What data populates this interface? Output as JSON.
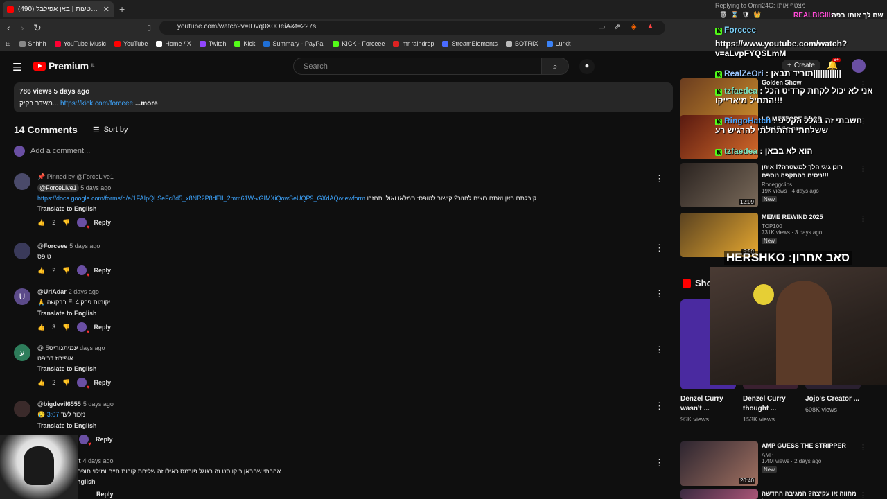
{
  "browser": {
    "tab_title": "(490) זו הייתה טעות | באן אפילבל",
    "tab_close": "✕",
    "new_tab": "+",
    "url": "youtube.com/watch?v=IDvq0X0OeiA&t=227s",
    "bookmarks": [
      "Shhhh",
      "YouTube Music",
      "YouTube",
      "Home / X",
      "Twitch",
      "Kick",
      "Summary - PayPal",
      "KICK - Forceee",
      "mr raindrop",
      "StreamElements",
      "BOTRIX",
      "Lurkit"
    ],
    "bookmark_colors": [
      "#888888",
      "#ff0033",
      "#ff0000",
      "#ffffff",
      "#9146ff",
      "#53fc18",
      "#1f6fd6",
      "#53fc18",
      "#d22",
      "#4a6bff",
      "#bbbbbb",
      "#3b82f6"
    ]
  },
  "youtube": {
    "logo_text": "Premium",
    "logo_sup": "IL",
    "search_placeholder": "Search",
    "create_label": "Create",
    "notif_count": "9+"
  },
  "description": {
    "views_line": "786 views  5 days ago",
    "text_prefix": "משדר בקיק...",
    "link": "https://kick.com/forceee",
    "more": "...more"
  },
  "comments": {
    "count_label": "14 Comments",
    "sort_label": "Sort by",
    "add_placeholder": "Add a comment...",
    "items": [
      {
        "pinned": "Pinned by @ForceLive1",
        "author": "@ForceLive1",
        "date": "5 days ago",
        "link": "https://docs.google.com/forms/d/e/1FAIpQLSeFc8d5_x8NR2P8dEII_2mm61W-vGIMXiQowSeUQP9_GXdAQ/viewform",
        "text": "קיבלתם באן ואתם רוצים לחזור?  קישור לטופס:  תמלאו ואולי תחזרו",
        "translate": "Translate to English",
        "likes": "2",
        "reply": "Reply"
      },
      {
        "author": "@Forceee",
        "date": "5 days ago",
        "text": "טופס",
        "likes": "2",
        "reply": "Reply"
      },
      {
        "author": "@UriAdar",
        "date": "2 days ago",
        "text": "🙏 בבקשה Ei 4 יקומות פרק",
        "translate": "Translate to English",
        "likes": "3",
        "reply": "Reply",
        "avatar_letter": "U"
      },
      {
        "author": "@עמיתנוריס",
        "date": "5 days ago",
        "text": "אופירוז דריפט",
        "translate": "Translate to English",
        "likes": "2",
        "reply": "Reply",
        "avatar_letter": "ע"
      },
      {
        "author": "@bigdevil6555",
        "date": "5 days ago",
        "text_prefix": "😢 נזכור לעד",
        "timestamp": "3:07",
        "translate": "Translate to English",
        "reply": "Reply"
      },
      {
        "author": "it",
        "date": "4 days ago",
        "text": "אהבתי שהבאן ריקווסט זה בגוגל פורמס כאילו זה שליחת קורות חיים ומילוי תופס",
        "translate": "nglish",
        "reply": "Reply"
      }
    ]
  },
  "sidebar": {
    "recs": [
      {
        "title": "Golden Show",
        "channel": "",
        "meta": "",
        "duration": "",
        "colors": [
          "#6b3d1f",
          "#c98a2b"
        ]
      },
      {
        "title": "LO METZOPE SOCR",
        "channel": "Bazzi B // תוכניות",
        "meta": "",
        "duration": "",
        "colors": [
          "#5a1a10",
          "#d46a2a"
        ]
      },
      {
        "title": "רונן גיגי הלך למשטרה?! איתן ניסים בהתקפה נוספת!!!",
        "channel": "Roneggclips",
        "meta": "19K views · 4 days ago",
        "duration": "12:09",
        "badge": "New",
        "colors": [
          "#2a2320",
          "#7a6a5a"
        ]
      },
      {
        "title": "MEME REWIND 2025",
        "channel": "TOP100",
        "meta": "731K views · 3 days ago",
        "duration": "6:50",
        "badge": "New",
        "colors": [
          "#5a4220",
          "#e6a830"
        ]
      },
      {
        "title": "AMP GUESS THE STRIPPER",
        "channel": "AMP",
        "meta": "1.4M views · 2 days ago",
        "duration": "20:40",
        "badge": "New",
        "colors": [
          "#2d2530",
          "#a07060"
        ]
      },
      {
        "title": "מחווה או עקיצה? המגיבה החדשה של",
        "channel": "",
        "meta": "",
        "duration": "",
        "colors": [
          "#3a2a40",
          "#aa5577"
        ]
      }
    ],
    "shorts_label": "Sho",
    "shorts": [
      {
        "title": "Denzel Curry wasn't ...",
        "views": "95K views",
        "color": "#4a2aa0"
      },
      {
        "title": "Denzel Curry thought ...",
        "views": "153K views",
        "color": "#3a2030"
      },
      {
        "title": "Jojo's Creator ...",
        "views": "608K views",
        "color": "#2a2030"
      }
    ]
  },
  "chat": {
    "replying": "Replying to Omri24G: מצטף אותו",
    "realbig": "REALBIGIII:",
    "realbig_msg": "שם לך אותו בפה",
    "lines": [
      {
        "user": "Forceee",
        "msg": "",
        "color": "#7dd3fc"
      },
      {
        "user": "",
        "msg": "https://www.youtube.com/watch?v=aLvpFYQSLmM",
        "color": "#ffffff"
      },
      {
        "user": "RealZeOri",
        "msg": ": תוריד תבאן||||||||||||",
        "color": "#9bc7ff"
      },
      {
        "user": "tzfaedea",
        "msg": ": אני לא יכול לקחת קרדיט הכל התחיל מיארייקו!!!",
        "color": "#7de3c0"
      },
      {
        "user": "RingoHatch",
        "msg": ": חשבתי זה בגלל הקליפ ששלחתי ההתחלתי להרגיש רע",
        "color": "#4aa6ff"
      },
      {
        "user": "tzfaedea",
        "msg": ": הוא לא בבאן",
        "color": "#7de3c0"
      }
    ]
  },
  "overlay_text": "סאב אחרון: HERSHKO"
}
